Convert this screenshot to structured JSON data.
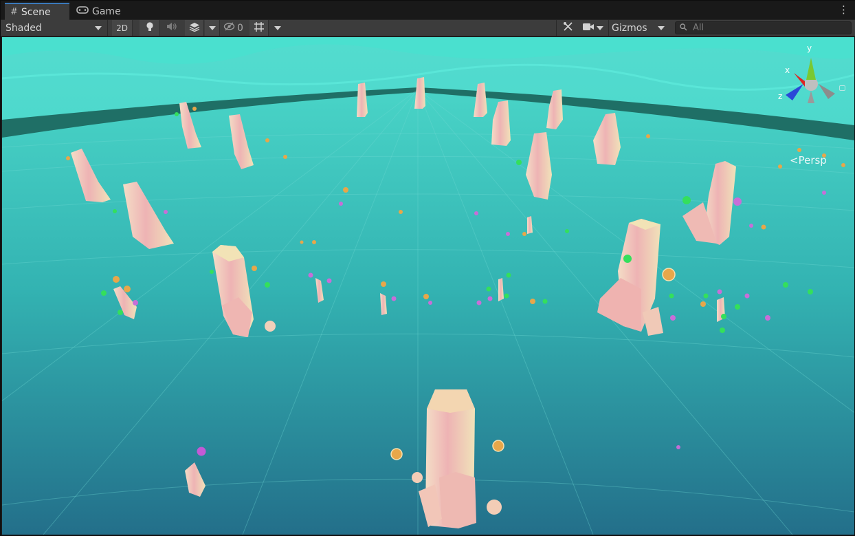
{
  "tabs": [
    {
      "label": "Scene",
      "icon": "grid-icon",
      "active": true
    },
    {
      "label": "Game",
      "icon": "gamepad-icon",
      "active": false
    }
  ],
  "toolbar": {
    "shading_mode": "Shaded",
    "mode_2d": "2D",
    "hidden_count": "0",
    "gizmos_label": "Gizmos",
    "search_placeholder": "All"
  },
  "scene": {
    "projection_label": "Persp",
    "gizmo_axes": {
      "x": "x",
      "y": "y",
      "z": "z"
    },
    "colors": {
      "sky": "#46d8cc",
      "water_far": "#3fcfc4",
      "ground_near": "#2a8f9b",
      "wall": "#1e6f68",
      "crystal_light": "#f2e8c8",
      "crystal_pink": "#e8a3a8",
      "flower_green": "#3fe06a",
      "flower_orange": "#e8a64a",
      "flower_purple": "#c86ed8",
      "gizmo_x": "#e02020",
      "gizmo_y": "#7ac832",
      "gizmo_z": "#2a48d8"
    }
  }
}
